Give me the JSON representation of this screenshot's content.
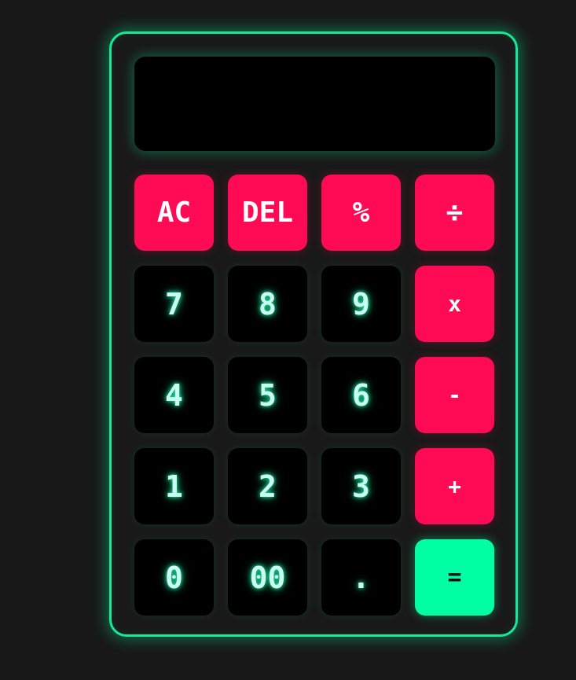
{
  "display": {
    "value": ""
  },
  "keys": [
    [
      "AC",
      "DEL",
      "%",
      "÷"
    ],
    [
      "7",
      "8",
      "9",
      "x"
    ],
    [
      "4",
      "5",
      "6",
      "-"
    ],
    [
      "1",
      "2",
      "3",
      "+"
    ],
    [
      "0",
      "00",
      ".",
      "="
    ]
  ],
  "colors": {
    "background": "#181818",
    "frame_border": "#17e89a",
    "operator_key": "#ff0a54",
    "number_key": "#000000",
    "equals_key": "#00ffa3",
    "number_text": "#c9fff0"
  }
}
